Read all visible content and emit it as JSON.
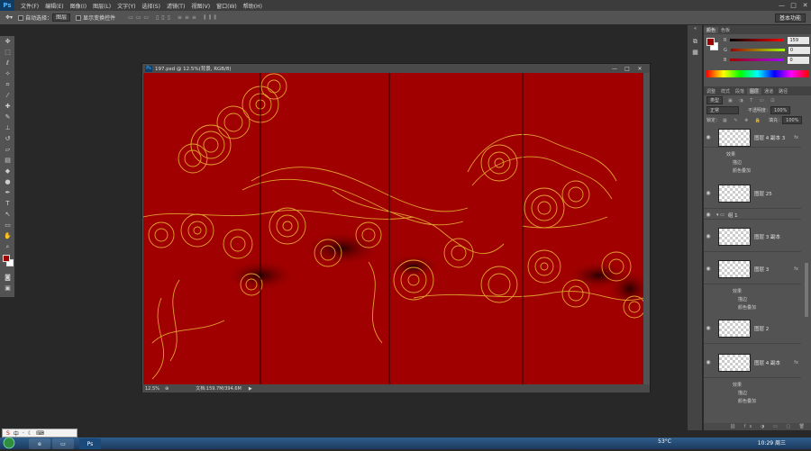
{
  "menubar": {
    "logo": "Ps",
    "items": [
      "文件(F)",
      "编辑(E)",
      "图像(I)",
      "图层(L)",
      "文字(Y)",
      "选择(S)",
      "滤镜(T)",
      "视图(V)",
      "窗口(W)",
      "帮助(H)"
    ],
    "minimize": "—",
    "maximize": "□",
    "close": "✕"
  },
  "options": {
    "auto_select_label": "自动选择：",
    "auto_select_value": "图层",
    "show_transform_label": "显示变换控件",
    "workspace": "基本功能"
  },
  "document": {
    "title": "197.psd @ 12.5%(背景, RGB/8)",
    "zoom": "12.5%",
    "doc_info": "文档:159.7M/394.6M"
  },
  "color_panel": {
    "tabs": [
      "颜色",
      "色板"
    ],
    "channels": [
      {
        "label": "R",
        "value": "159"
      },
      {
        "label": "G",
        "value": "0"
      },
      {
        "label": "B",
        "value": "0"
      }
    ],
    "foreground": "#a10000",
    "background": "#ffffff"
  },
  "layers_panel": {
    "tabs": [
      "调整",
      "样式",
      "段落",
      "图层",
      "通道",
      "路径"
    ],
    "filter_kind": "类型",
    "blend_mode": "正常",
    "opacity_label": "不透明度：",
    "opacity": "100%",
    "lock_label": "锁定：",
    "fill_label": "填充：",
    "fill": "100%",
    "layers": [
      {
        "name": "图层 4 副本 3",
        "fx": "fx",
        "effects": [
          "效果",
          "描边",
          "颜色叠加"
        ]
      },
      {
        "name": "图层 25",
        "fx": "",
        "effects": []
      },
      {
        "name": "组 1",
        "fx": "",
        "effects": []
      },
      {
        "name": "图层 3 副本",
        "fx": "",
        "effects": []
      },
      {
        "name": "图层 3",
        "fx": "fx",
        "effects": [
          "效果",
          "描边",
          "颜色叠加"
        ]
      },
      {
        "name": "图层 2",
        "fx": "",
        "effects": []
      },
      {
        "name": "图层 4 副本",
        "fx": "fx",
        "effects": [
          "效果",
          "描边",
          "颜色叠加"
        ]
      }
    ]
  },
  "ime": {
    "chars": [
      "中",
      "·",
      "☾",
      "⌨"
    ]
  },
  "taskbar": {
    "ps_label": "Ps",
    "weather": "53°C",
    "clock": "10:29 周三"
  },
  "colors": {
    "canvas": "#a10000",
    "gold": "#e0a030",
    "panel": "#535353"
  }
}
